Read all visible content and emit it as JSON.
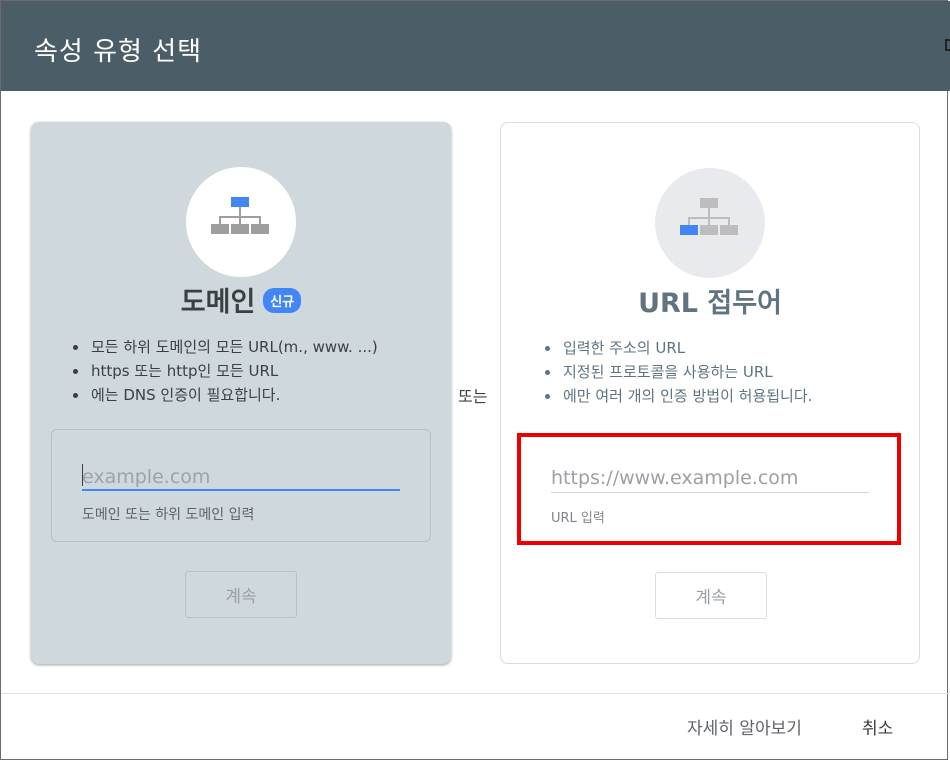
{
  "dialog": {
    "title": "속성 유형 선택"
  },
  "domain_card": {
    "title": "도메인",
    "badge": "신규",
    "icon": "sitemap-icon",
    "features": [
      "모든 하위 도메인의 모든 URL(m., www. ...)",
      "https 또는 http인 모든 URL",
      "에는 DNS 인증이 필요합니다."
    ],
    "input": {
      "value": "",
      "placeholder": "example.com",
      "helper": "도메인 또는 하위 도메인 입력"
    },
    "continue_label": "계속"
  },
  "separator": {
    "or_label": "또는"
  },
  "url_card": {
    "title": "URL 접두어",
    "icon": "sitemap-icon",
    "features": [
      "입력한 주소의 URL",
      "지정된 프로토콜을 사용하는 URL",
      "에만 여러 개의 인증 방법이 허용됩니다."
    ],
    "input": {
      "value": "",
      "placeholder": "https://www.example.com",
      "helper": "URL 입력"
    },
    "continue_label": "계속"
  },
  "footer": {
    "learn_more_label": "자세히 알아보기",
    "cancel_label": "취소"
  },
  "colors": {
    "header_bg": "#4b5d67",
    "domain_card_bg": "#cfd8dc",
    "accent_blue": "#4285f4",
    "highlight_red": "#ee0000"
  }
}
